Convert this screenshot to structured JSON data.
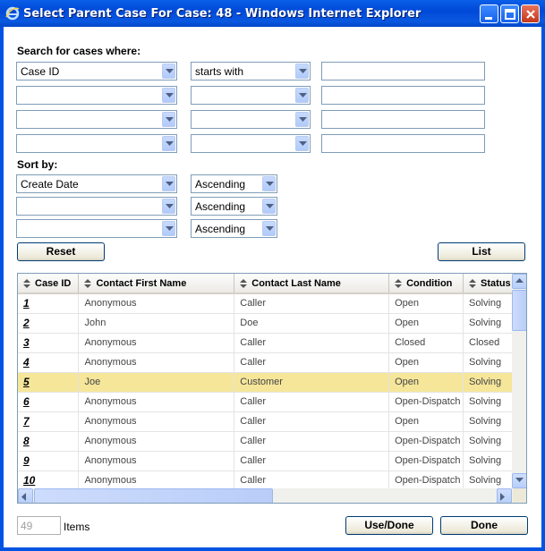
{
  "window": {
    "title": "Select Parent Case For Case: 48 - Windows Internet Explorer"
  },
  "search": {
    "heading": "Search for cases where:",
    "rows": [
      {
        "field": "Case ID",
        "operator": "starts with",
        "value": ""
      },
      {
        "field": "",
        "operator": "",
        "value": ""
      },
      {
        "field": "",
        "operator": "",
        "value": ""
      },
      {
        "field": "",
        "operator": "",
        "value": ""
      }
    ]
  },
  "sort": {
    "heading": "Sort by:",
    "rows": [
      {
        "field": "Create Date",
        "order": "Ascending"
      },
      {
        "field": "",
        "order": "Ascending"
      },
      {
        "field": "",
        "order": "Ascending"
      }
    ]
  },
  "buttons": {
    "reset": "Reset",
    "list": "List",
    "use_done": "Use/Done",
    "done": "Done"
  },
  "grid": {
    "columns": [
      "Case ID",
      "Contact First Name",
      "Contact Last Name",
      "Condition",
      "Status"
    ],
    "rows": [
      {
        "case_id": "1",
        "first": "Anonymous",
        "last": "Caller",
        "condition": "Open",
        "status": "Solving"
      },
      {
        "case_id": "2",
        "first": "John",
        "last": "Doe",
        "condition": "Open",
        "status": "Solving"
      },
      {
        "case_id": "3",
        "first": "Anonymous",
        "last": "Caller",
        "condition": "Closed",
        "status": "Closed"
      },
      {
        "case_id": "4",
        "first": "Anonymous",
        "last": "Caller",
        "condition": "Open",
        "status": "Solving"
      },
      {
        "case_id": "5",
        "first": "Joe",
        "last": "Customer",
        "condition": "Open",
        "status": "Solving"
      },
      {
        "case_id": "6",
        "first": "Anonymous",
        "last": "Caller",
        "condition": "Open-Dispatch",
        "status": "Solving"
      },
      {
        "case_id": "7",
        "first": "Anonymous",
        "last": "Caller",
        "condition": "Open",
        "status": "Solving"
      },
      {
        "case_id": "8",
        "first": "Anonymous",
        "last": "Caller",
        "condition": "Open-Dispatch",
        "status": "Solving"
      },
      {
        "case_id": "9",
        "first": "Anonymous",
        "last": "Caller",
        "condition": "Open-Dispatch",
        "status": "Solving"
      },
      {
        "case_id": "10",
        "first": "Anonymous",
        "last": "Caller",
        "condition": "Open-Dispatch",
        "status": "Solving"
      }
    ],
    "highlighted_row": 4
  },
  "footer": {
    "count": "49",
    "items_label": "Items"
  },
  "colors": {
    "titlebar": "#0054e3",
    "highlight_row": "#f5e69a"
  }
}
